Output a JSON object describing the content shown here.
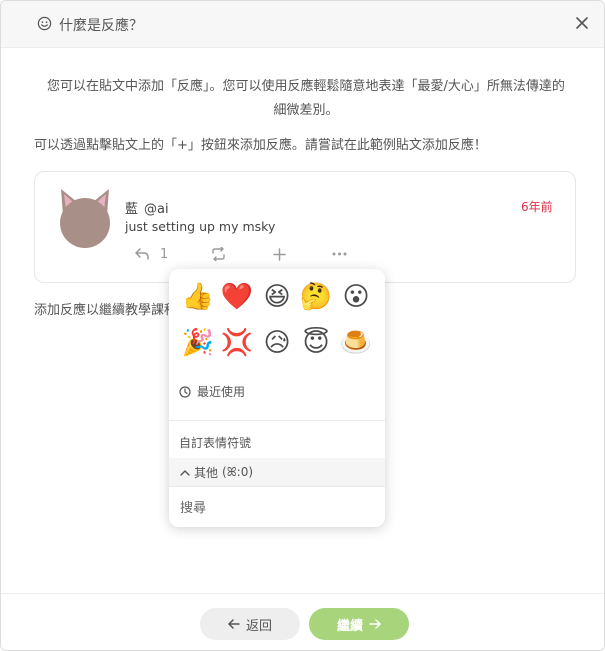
{
  "dialog": {
    "title": "什麼是反應？",
    "intro": "您可以在貼文中添加「反應」。您可以使用反應輕鬆隨意地表達「最愛/大心」所無法傳達的細微差別。",
    "hint": "可以透過點擊貼文上的「+」按鈕來添加反應。請嘗試在此範例貼文添加反應！",
    "note": "添加反應以繼續教學課程"
  },
  "post": {
    "display_name": "藍",
    "username": "@ai",
    "time": "6年前",
    "text": "just setting up my msky",
    "reply_count": "1"
  },
  "picker": {
    "emojis": [
      "👍",
      "❤️",
      "😆",
      "🤔",
      "😮",
      "🎉",
      "💢",
      "😥",
      "😇",
      "🍮"
    ],
    "recent_label": "最近使用",
    "custom_label": "自訂表情符號",
    "other_label": "其他",
    "other_count": "(ꕤ:0)",
    "search_placeholder": "搜尋"
  },
  "footer": {
    "back_label": "返回",
    "next_label": "繼續"
  },
  "colors": {
    "accent_green": "#a8d57c",
    "time_red": "#dd2e44"
  }
}
